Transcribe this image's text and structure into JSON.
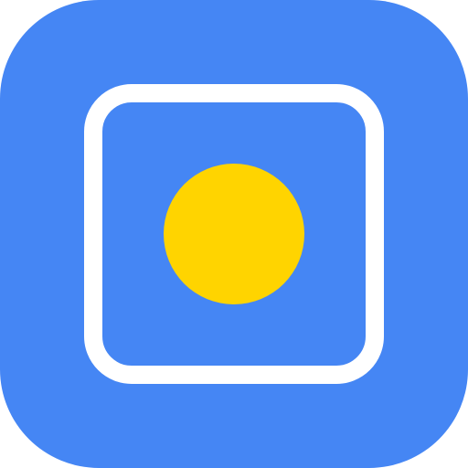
{
  "app_icon": {
    "icon_name": "app-icon",
    "colors": {
      "background": "#4586F4",
      "frame_stroke": "#FFFFFF",
      "dot": "#FFD400"
    },
    "elements": {
      "outer_tile": "rounded-square-background",
      "inner_frame": "rounded-square-outline",
      "center_dot": "filled-circle"
    }
  }
}
